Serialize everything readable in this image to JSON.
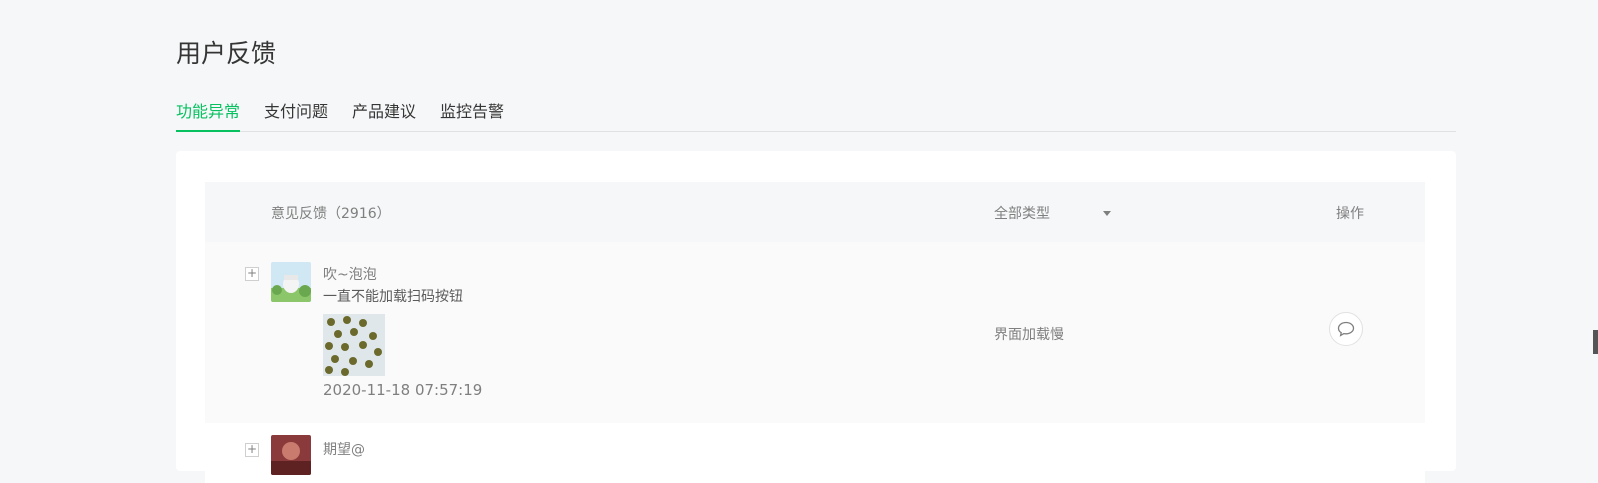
{
  "page": {
    "title": "用户反馈"
  },
  "tabs": [
    {
      "label": "功能异常",
      "active": true
    },
    {
      "label": "支付问题",
      "active": false
    },
    {
      "label": "产品建议",
      "active": false
    },
    {
      "label": "监控告警",
      "active": false
    }
  ],
  "table": {
    "header": {
      "feedback_label": "意见反馈（2916）",
      "type_filter": "全部类型",
      "action_label": "操作"
    },
    "rows": [
      {
        "nickname": "吹~泡泡",
        "content": "一直不能加载扫码按钮",
        "timestamp": "2020-11-18 07:57:19",
        "type": "界面加载慢",
        "expand_glyph": "+",
        "reply_icon": "comment-icon"
      },
      {
        "nickname": "期望@",
        "expand_glyph": "+"
      }
    ]
  },
  "colors": {
    "accent": "#07c160",
    "background": "#f6f7f8"
  }
}
